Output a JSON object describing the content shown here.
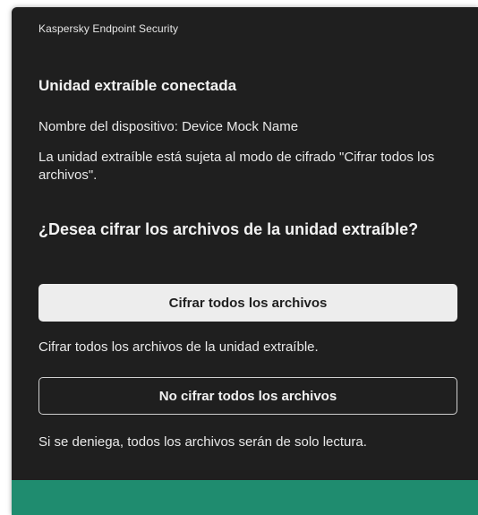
{
  "window": {
    "app_title": "Kaspersky Endpoint Security"
  },
  "notification": {
    "heading": "Unidad extraíble conectada",
    "device_name_line": "Nombre del dispositivo: Device Mock Name",
    "mode_line": "La unidad extraíble está sujeta al modo de cifrado \"Cifrar todos los archivos\".",
    "question": "¿Desea cifrar los archivos de la unidad extraíble?",
    "encrypt_button_label": "Cifrar todos los archivos",
    "encrypt_description": "Cifrar todos los archivos de la unidad extraíble.",
    "no_encrypt_button_label": "No cifrar todos los archivos",
    "no_encrypt_description": "Si se deniega, todos los archivos serán de solo lectura."
  },
  "colors": {
    "window_background": "#1f1f1f",
    "accent_bar": "#1f8c6f",
    "primary_button": "#ededed"
  }
}
